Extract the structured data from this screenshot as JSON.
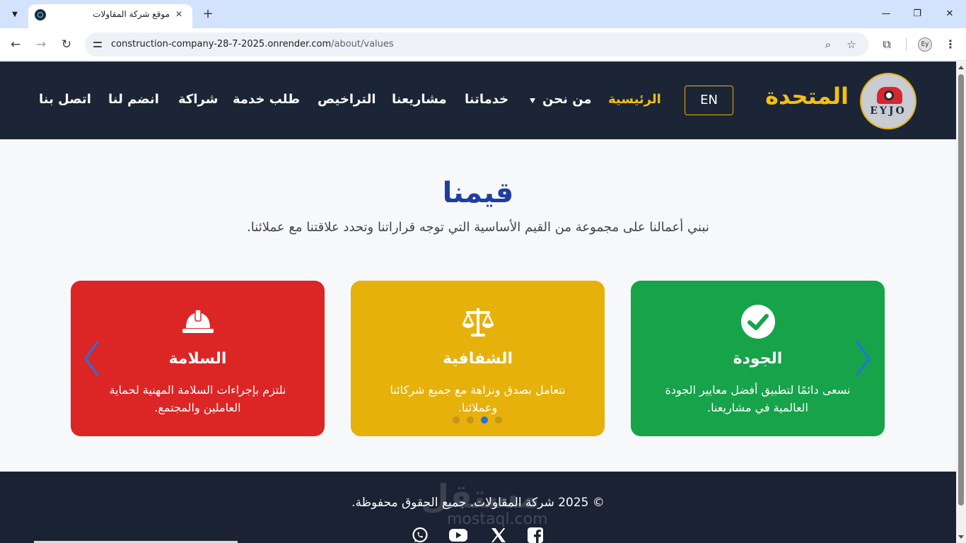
{
  "browser": {
    "tab_title": "موقع شركة المقاولات",
    "tab_close": "✕",
    "new_tab": "+",
    "url_host": "construction-company-28-7-2025.onrender.com",
    "url_path": "/about/values",
    "profile_initials": "Ey",
    "window_controls": {
      "minimize": "—",
      "restore": "❐",
      "close": "✕"
    }
  },
  "site": {
    "logo_text": "EYJO",
    "brand_name": "المتحدة",
    "lang_button": "EN",
    "nav": {
      "home": "الرئيسية",
      "about": "من نحن",
      "services": "خدماتنا",
      "projects": "مشاريعنا",
      "licenses": "التراخيص",
      "service_request": "طلب خدمة",
      "partnership": "شراكة",
      "join_us": "انضم لنا",
      "contact_us": "اتصل بنا"
    }
  },
  "values_section": {
    "title": "قيمنا",
    "subtitle": "نبني أعمالنا على مجموعة من القيم الأساسية التي توجه قراراتنا وتحدد علاقتنا مع عملائنا.",
    "cards": [
      {
        "icon": "check-circle-icon",
        "color": "#16a34a",
        "title": "الجودة",
        "text": "نسعى دائمًا لتطبيق أفضل معايير الجودة العالمية في مشاريعنا."
      },
      {
        "icon": "scales-icon",
        "color": "#e6b10a",
        "title": "الشفافية",
        "text": "نتعامل بصدق ونزاهة مع جميع شركائنا وعملائنا."
      },
      {
        "icon": "hard-hat-icon",
        "color": "#dc2626",
        "title": "السلامة",
        "text": "نلتزم بإجراءات السلامة المهنية لحماية العاملين والمجتمع."
      }
    ],
    "carousel": {
      "dot_count": 4,
      "active_dot": 2
    }
  },
  "footer": {
    "copyright": "© 2025 شركة المقاولات. جميع الحقوق محفوظة.",
    "social_icons": [
      "whatsapp-icon",
      "youtube-icon",
      "x-icon",
      "facebook-icon"
    ]
  },
  "watermark": {
    "text": "مستقل",
    "url": "mostaql.com"
  },
  "colors": {
    "header_bg": "#1c2536",
    "accent": "#f5bf13",
    "title_blue": "#1f3f9e",
    "arrow_blue": "#1e74e6"
  }
}
